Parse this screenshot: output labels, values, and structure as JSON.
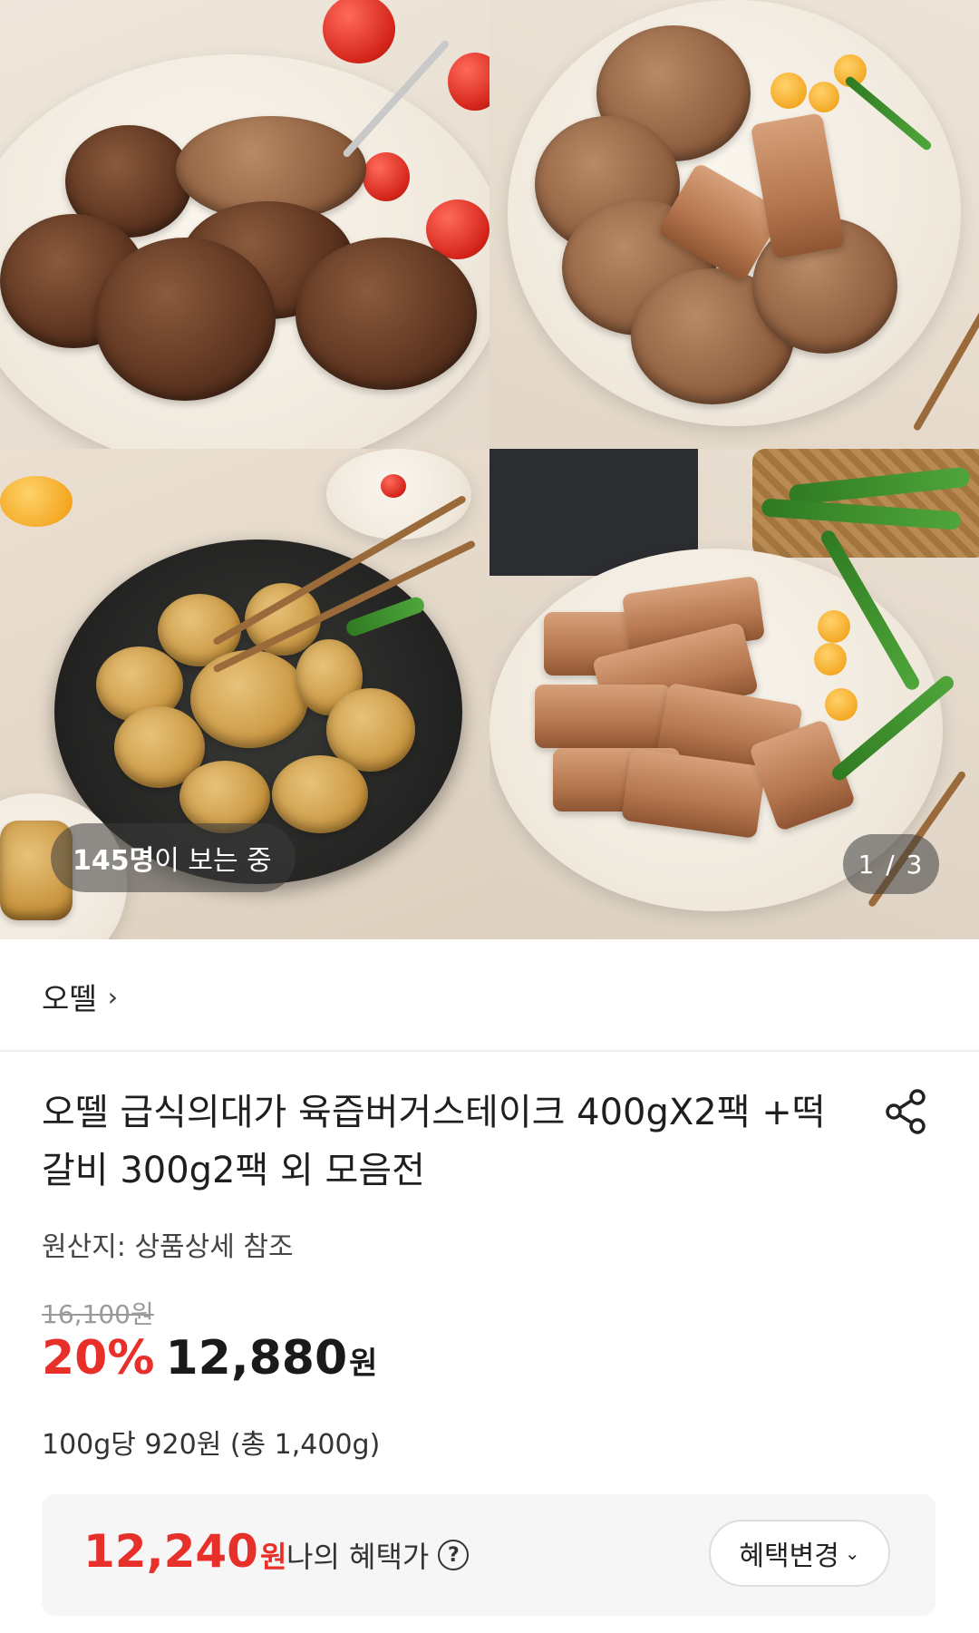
{
  "gallery": {
    "viewer_count": "145명",
    "viewer_suffix": "이 보는 중",
    "pager": "1 / 3"
  },
  "brand": {
    "name": "오뗄",
    "chevron": "›"
  },
  "product": {
    "title": "오뗄 급식의대가 육즙버거스테이크 400gX2팩 +떡갈비 300g2팩 외 모음전",
    "share_icon": "share-icon",
    "origin": "원산지: 상품상세 참조",
    "original_price": "16,100원",
    "discount": "20%",
    "sale_price": "12,880",
    "currency": "원",
    "unit_price": "100g당 920원 (총 1,400g)"
  },
  "benefit": {
    "price": "12,240",
    "currency": "원",
    "label": "나의 혜택가",
    "help_icon": "?",
    "change_button": "혜택변경",
    "change_chevron": "⌄"
  },
  "colors": {
    "accent_red": "#e8302a",
    "text_dark": "#1e1e1e",
    "benefit_bg": "#f6f6f7"
  }
}
